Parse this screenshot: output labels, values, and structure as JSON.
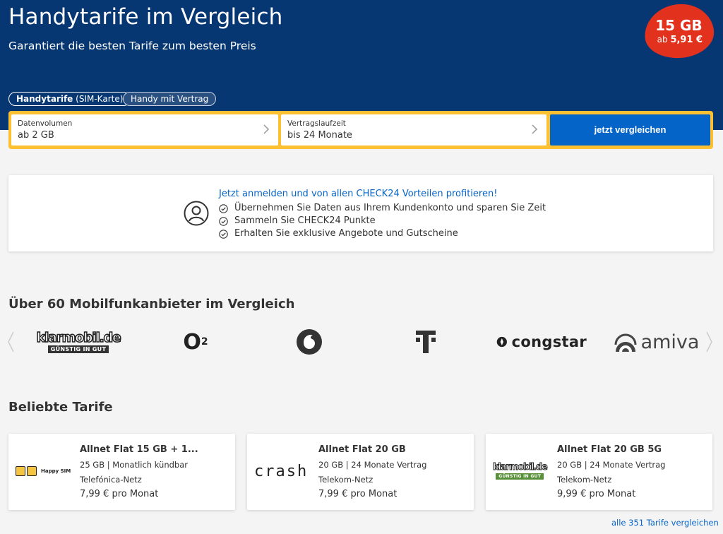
{
  "hero": {
    "title": "Handytarife im Vergleich",
    "subtitle": "Garantiert die besten Tarife zum besten Preis",
    "badge_big": "15 GB",
    "badge_prefix": "ab",
    "badge_price": "5,91 €"
  },
  "tabs": [
    {
      "label_bold": "Handytarife",
      "label_rest": "(SIM-Karte)",
      "active": true
    },
    {
      "label": "Handy mit Vertrag",
      "active": false
    }
  ],
  "search": {
    "volume_label": "Datenvolumen",
    "volume_value": "ab 2 GB",
    "term_label": "Vertragslaufzeit",
    "term_value": "bis 24 Monate",
    "submit_label": "jetzt vergleichen"
  },
  "login": {
    "headline": "Jetzt anmelden und von allen CHECK24 Vorteilen profitieren!",
    "benefits": [
      "Übernehmen Sie Daten aus Ihrem Kundenkonto und sparen Sie Zeit",
      "Sammeln Sie CHECK24 Punkte",
      "Erhalten Sie exklusive Angebote und Gutscheine"
    ]
  },
  "providers": {
    "heading": "Über 60 Mobilfunkanbieter im Vergleich",
    "logos": [
      {
        "name": "klarmobil.de",
        "tagline": "GÜNSTIG IN GUT"
      },
      {
        "name": "O",
        "sub": "2"
      },
      {
        "name": "vodafone-icon"
      },
      {
        "name": "telekom-icon"
      },
      {
        "name": "congstar"
      },
      {
        "name": "amiva"
      }
    ]
  },
  "tariffs": {
    "heading": "Beliebte Tarife",
    "cards": [
      {
        "logo_text": "Happy SIM",
        "title": "Allnet Flat 15 GB + 1...",
        "line1": "25 GB | Monatlich kündbar",
        "line2": "Telefónica-Netz",
        "price": "7,99 € pro Monat"
      },
      {
        "logo_text": "crash",
        "title": "Allnet Flat 20 GB",
        "line1": "20 GB | 24 Monate Vertrag",
        "line2": "Telekom-Netz",
        "price": "7,99 € pro Monat"
      },
      {
        "logo_text": "klarmobil.de",
        "logo_tagline": "GÜNSTIG IN GUT",
        "title": "Allnet Flat 20 GB 5G",
        "line1": "20 GB | 24 Monate Vertrag",
        "line2": "Telekom-Netz",
        "price": "9,99 € pro Monat"
      }
    ],
    "all_link": "alle 351 Tarife vergleichen"
  },
  "colors": {
    "hero_bg": "#063773",
    "badge": "#e2321d",
    "search_frame": "#fdc033",
    "primary": "#0564c8"
  }
}
